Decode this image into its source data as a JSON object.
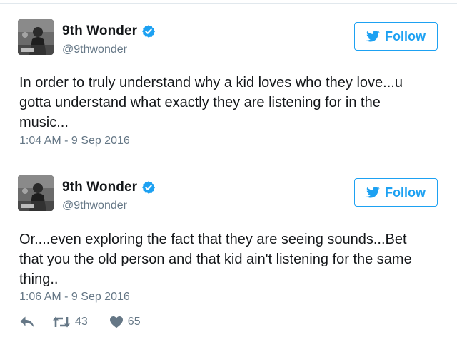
{
  "tweets": [
    {
      "display_name": "9th Wonder",
      "handle": "@9thwonder",
      "follow_label": "Follow",
      "text": "In order to truly understand why a kid loves who they love...u gotta understand what exactly they are listening for in the music...",
      "timestamp": "1:04 AM - 9 Sep 2016"
    },
    {
      "display_name": "9th Wonder",
      "handle": "@9thwonder",
      "follow_label": "Follow",
      "text": "Or....even exploring the fact that they are seeing sounds...Bet that you the old person and that kid ain't listening for the same thing..",
      "timestamp": "1:06 AM - 9 Sep 2016",
      "retweets": "43",
      "likes": "65"
    }
  ],
  "icons": {
    "verified": "verified-badge-icon",
    "follow": "twitter-bird-icon",
    "reply": "reply-icon",
    "retweet": "retweet-icon",
    "like": "heart-icon"
  },
  "colors": {
    "accent": "#1da1f2",
    "text": "#14171a",
    "muted": "#657786",
    "divider": "#e1e8ed"
  }
}
